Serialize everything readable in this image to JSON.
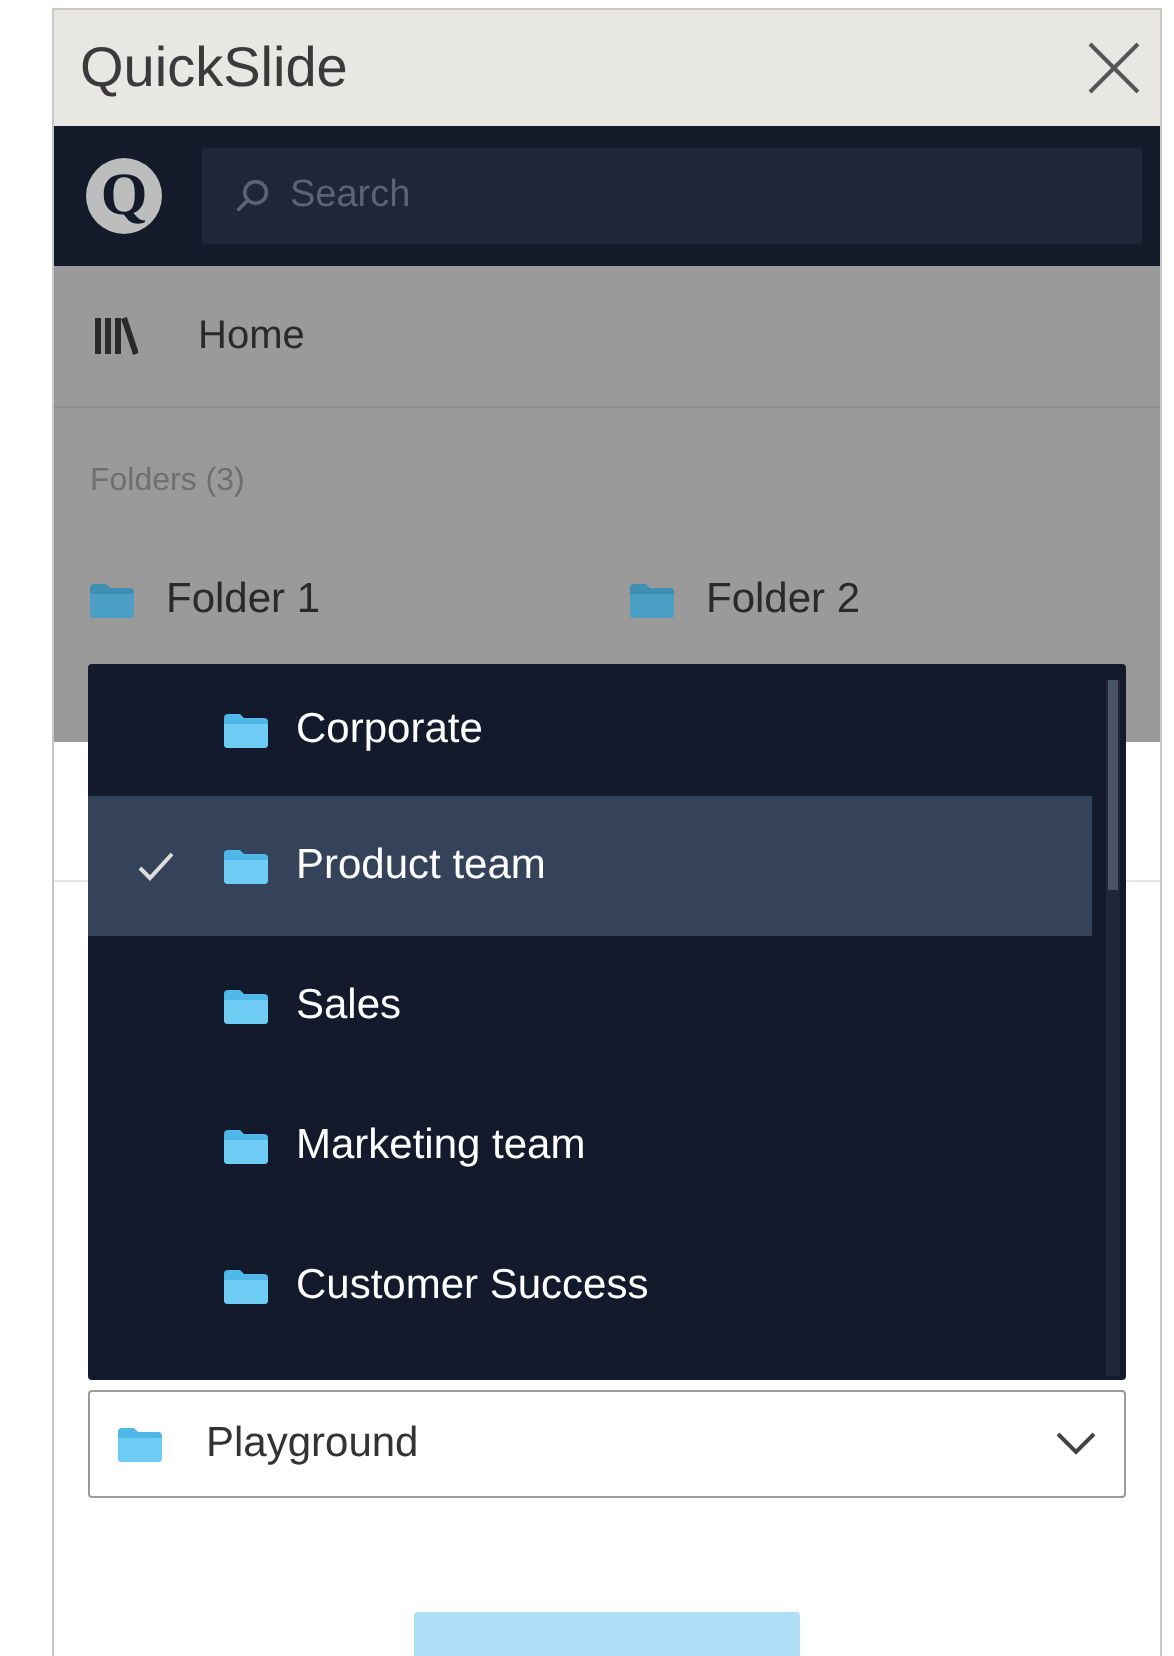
{
  "window": {
    "title": "QuickSlide"
  },
  "logo": {
    "letter": "Q"
  },
  "search": {
    "placeholder": "Search"
  },
  "nav": {
    "label": "Home"
  },
  "folders": {
    "heading": "Folders (3)",
    "items": [
      {
        "name": "Folder 1"
      },
      {
        "name": "Folder 2"
      }
    ]
  },
  "folder_dropdown": {
    "expanded": true,
    "value": "Playground",
    "options": [
      {
        "name": "Corporate",
        "selected": false
      },
      {
        "name": "Product team",
        "selected": true
      },
      {
        "name": "Sales",
        "selected": false
      },
      {
        "name": "Marketing team",
        "selected": false
      },
      {
        "name": "Customer Success",
        "selected": false
      }
    ]
  },
  "primary_button": {
    "disabled": true
  }
}
